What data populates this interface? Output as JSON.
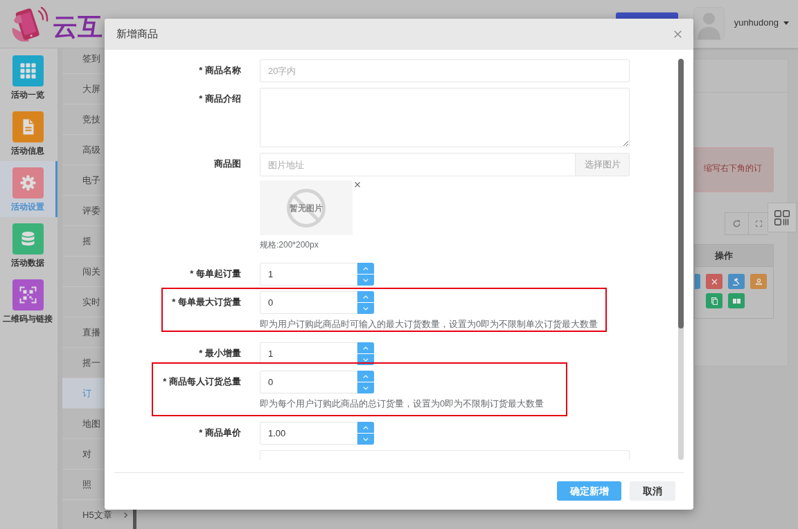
{
  "header": {
    "logo_text": "云互",
    "username": "yunhudong"
  },
  "nav_primary": [
    {
      "label": "活动一览",
      "color": "#1fa5c8",
      "selected": false
    },
    {
      "label": "活动信息",
      "color": "#d8841e",
      "selected": false
    },
    {
      "label": "活动设置",
      "color": "#d9808b",
      "selected": true
    },
    {
      "label": "活动数据",
      "color": "#3bb27a",
      "selected": false
    },
    {
      "label": "二维码与链接",
      "color": "#a855c8",
      "selected": false
    }
  ],
  "nav_secondary": [
    {
      "label": "签到",
      "selected": false
    },
    {
      "label": "大屏",
      "selected": false
    },
    {
      "label": "竞技",
      "selected": false
    },
    {
      "label": "高级",
      "selected": false
    },
    {
      "label": "电子",
      "selected": false
    },
    {
      "label": "评委",
      "selected": false
    },
    {
      "label": "摇",
      "selected": false
    },
    {
      "label": "闯关",
      "selected": false
    },
    {
      "label": "实时",
      "selected": false
    },
    {
      "label": "直播",
      "selected": false
    },
    {
      "label": "摇一",
      "selected": false
    },
    {
      "label": "订",
      "selected": true
    },
    {
      "label": "地图",
      "selected": false
    },
    {
      "label": "对",
      "selected": false
    },
    {
      "label": "照",
      "selected": false
    },
    {
      "label": "H5文章",
      "selected": false,
      "has_submenu": true
    }
  ],
  "content": {
    "alert": "缩写右下角的订",
    "table": {
      "column": "操作",
      "action_rows": [
        [
          {
            "kind": "partial",
            "color": "#4a8fc4"
          },
          {
            "kind": "full",
            "color": "#c6605c"
          },
          {
            "kind": "full",
            "color": "#4a8fc4"
          },
          {
            "kind": "full",
            "color": "#c98a48"
          }
        ],
        [
          {
            "kind": "full",
            "color": "#2a9f68"
          },
          {
            "kind": "full",
            "color": "#2a9f68"
          }
        ]
      ]
    }
  },
  "modal": {
    "title": "新增商品",
    "fields": [
      {
        "kind": "text",
        "label": "* 商品名称",
        "placeholder": "20字内",
        "highlighted": false
      },
      {
        "kind": "textarea",
        "label": "* 商品介绍",
        "highlighted": false
      },
      {
        "kind": "image",
        "label": "商品图",
        "placeholder": "图片地址",
        "button": "选择图片",
        "preview": "暂无图片",
        "note": "规格:200*200px",
        "highlighted": false
      },
      {
        "kind": "number",
        "label": "* 每单起订量",
        "value": "1",
        "highlighted": false
      },
      {
        "kind": "number",
        "label": "* 每单最大订货量",
        "value": "0",
        "help": "即为用户订购此商品时可输入的最大订货数量，设置为0即为不限制单次订货最大数量",
        "highlighted": true
      },
      {
        "kind": "number",
        "label": "* 最小增量",
        "value": "1",
        "highlighted": false
      },
      {
        "kind": "number",
        "label": "* 商品每人订货总量",
        "value": "0",
        "help": "即为每个用户订购此商品的总订货量，设置为0即为不限制订货最大数量",
        "highlighted": true
      },
      {
        "kind": "number",
        "label": "* 商品单价",
        "value": "1.00",
        "highlighted": false
      },
      {
        "kind": "text",
        "highlighted": false
      }
    ],
    "buttons": [
      {
        "label": "确定新增",
        "kind": "primary"
      },
      {
        "label": "取消",
        "kind": "secondary"
      }
    ]
  }
}
